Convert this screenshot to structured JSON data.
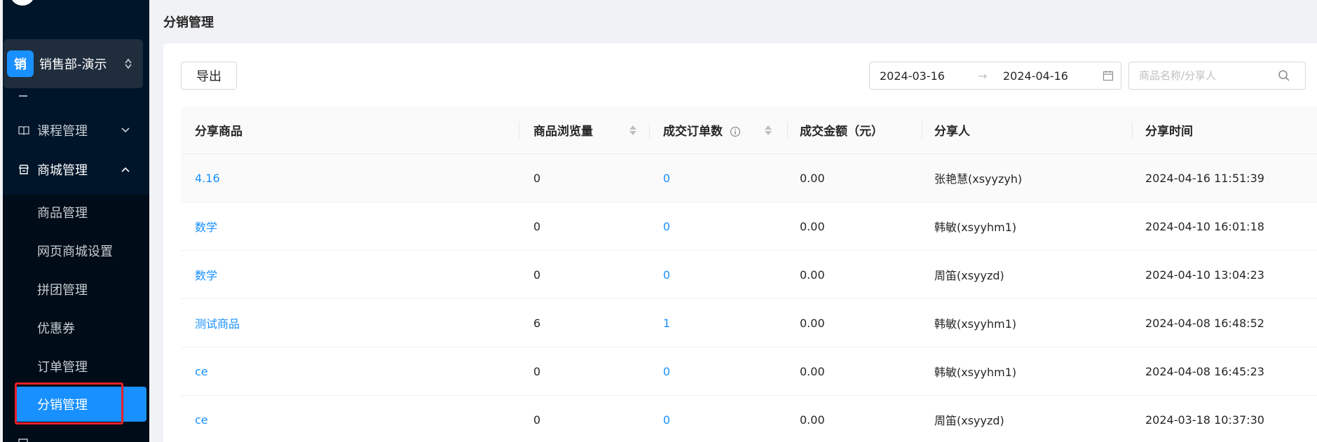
{
  "sidebar": {
    "org": {
      "badge": "销",
      "name": "销售部-演示"
    },
    "menu": [
      {
        "label": "课程管理",
        "icon": "book-icon",
        "expanded": false
      },
      {
        "label": "商城管理",
        "icon": "store-icon",
        "expanded": true
      }
    ],
    "submenu": [
      {
        "label": "商品管理"
      },
      {
        "label": "网页商城设置"
      },
      {
        "label": "拼团管理"
      },
      {
        "label": "优惠券"
      },
      {
        "label": "订单管理"
      },
      {
        "label": "分销管理",
        "active": true
      }
    ]
  },
  "page": {
    "title": "分销管理"
  },
  "toolbar": {
    "export_label": "导出",
    "date_start": "2024-03-16",
    "date_arrow": "→",
    "date_end": "2024-04-16",
    "search_placeholder": "商品名称/分享人"
  },
  "table": {
    "headers": [
      "分享商品",
      "商品浏览量",
      "成交订单数",
      "成交金额（元）",
      "分享人",
      "分享时间"
    ],
    "rows": [
      {
        "product": "4.16",
        "views": "0",
        "orders": "0",
        "amount": "0.00",
        "sharer": "张艳慧(xsyyzyh)",
        "time": "2024-04-16 11:51:39"
      },
      {
        "product": "数学",
        "views": "0",
        "orders": "0",
        "amount": "0.00",
        "sharer": "韩敏(xsyyhm1)",
        "time": "2024-04-10 16:01:18"
      },
      {
        "product": "数学",
        "views": "0",
        "orders": "0",
        "amount": "0.00",
        "sharer": "周笛(xsyyzd)",
        "time": "2024-04-10 13:04:23"
      },
      {
        "product": "测试商品",
        "views": "6",
        "orders": "1",
        "amount": "0.00",
        "sharer": "韩敏(xsyyhm1)",
        "time": "2024-04-08 16:48:52"
      },
      {
        "product": "ce",
        "views": "0",
        "orders": "0",
        "amount": "0.00",
        "sharer": "韩敏(xsyyhm1)",
        "time": "2024-04-08 16:45:23"
      },
      {
        "product": "ce",
        "views": "0",
        "orders": "0",
        "amount": "0.00",
        "sharer": "周笛(xsyyzd)",
        "time": "2024-03-18 10:37:30"
      }
    ]
  },
  "colors": {
    "sidebar_bg": "#001529",
    "submenu_bg": "#000c17",
    "accent": "#1890ff",
    "highlight": "#e8202a"
  }
}
